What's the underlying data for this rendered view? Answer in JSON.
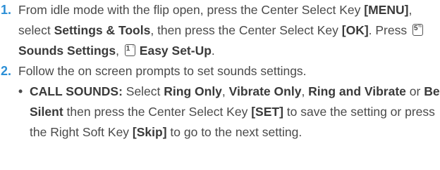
{
  "steps": [
    {
      "number": "1.",
      "parts": {
        "t1": "From idle mode with the flip open, press the Center Select Key ",
        "menu": "[MENU]",
        "t2": ", select ",
        "settings_tools": "Settings & Tools",
        "t3": ", then press the Center Select Key ",
        "ok": "[OK]",
        "t4": ". Press ",
        "key5_digit": "5",
        "key5_sub": "%",
        "sounds_settings": "Sounds Settings",
        "t5": ", ",
        "key1_digit": "1",
        "key1_sub": "!",
        "easy_setup": "Easy Set-Up",
        "t6": "."
      }
    },
    {
      "number": "2.",
      "text": "Follow the on screen prompts to set sounds settings."
    }
  ],
  "bullet": {
    "dot": "•",
    "parts": {
      "call_sounds": "CALL SOUNDS:",
      "t1": " Select ",
      "ring_only": "Ring Only",
      "t2": ", ",
      "vibrate_only": "Vibrate Only",
      "t3": ", ",
      "ring_and_vibrate": "Ring and Vibrate",
      "t4": " or ",
      "be_silent": "Be Silent",
      "t5": " then press the Center Select Key ",
      "set": "[SET]",
      "t6": " to save the setting or press the Right Soft Key ",
      "skip": "[Skip]",
      "t7": " to go to the next setting."
    }
  },
  "colors": {
    "step_number": "#2c8fd6",
    "body_text": "#4a4a4a"
  }
}
